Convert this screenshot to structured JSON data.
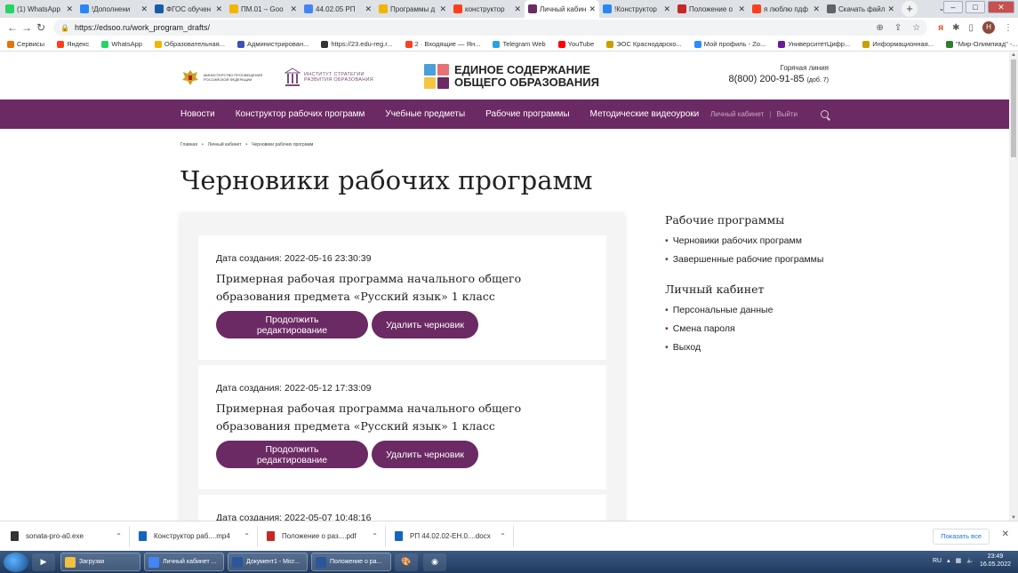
{
  "browser": {
    "tabs": [
      {
        "title": "(1) WhatsApp",
        "color": "#25d366",
        "active": false
      },
      {
        "title": "!Дополнени",
        "color": "#2787f5",
        "active": false
      },
      {
        "title": "ФГОС обучен",
        "color": "#1a5aa8",
        "active": false
      },
      {
        "title": "ПМ.01 – Goo",
        "color": "#f4b400",
        "active": false
      },
      {
        "title": "44.02.05 РП",
        "color": "#4285f4",
        "active": false
      },
      {
        "title": "Программы д",
        "color": "#f4b400",
        "active": false
      },
      {
        "title": "конструктор",
        "color": "#fc3f1d",
        "active": false
      },
      {
        "title": "Личный кабин",
        "color": "#6b2a63",
        "active": true
      },
      {
        "title": "!Конструктор",
        "color": "#2787f5",
        "active": false
      },
      {
        "title": "Положение о",
        "color": "#c62828",
        "active": false
      },
      {
        "title": "я люблю пдф",
        "color": "#fc3f1d",
        "active": false
      },
      {
        "title": "Скачать файл",
        "color": "#5f6368",
        "active": false
      }
    ],
    "url": "https://edsoo.ru/work_program_drafts/",
    "profile_initial": "Н",
    "bookmarks": [
      {
        "label": "Сервисы",
        "color": "#e8710a"
      },
      {
        "label": "Яндекс",
        "color": "#fc3f1d"
      },
      {
        "label": "WhatsApp",
        "color": "#25d366"
      },
      {
        "label": "Образовательная...",
        "color": "#f4b400"
      },
      {
        "label": "Администрирован...",
        "color": "#3f51b5"
      },
      {
        "label": "https://23.edu-reg.r...",
        "color": "#333333"
      },
      {
        "label": "2 · Входящие — Ян...",
        "color": "#fc3f1d"
      },
      {
        "label": "Telegram Web",
        "color": "#2aa3df"
      },
      {
        "label": "YouTube",
        "color": "#ff0000"
      },
      {
        "label": "ЭОС Краснодарско...",
        "color": "#c7a000"
      },
      {
        "label": "Мой профиль - Zo...",
        "color": "#2d8cff"
      },
      {
        "label": "УниверситетЦифр...",
        "color": "#6a1b9a"
      },
      {
        "label": "Информационная...",
        "color": "#c7a000"
      },
      {
        "label": "\"Мир-Олимпиад\" -...",
        "color": "#2e7d32"
      }
    ]
  },
  "site": {
    "logo_ministry": "МИНИСТЕРСТВО ПРОСВЕЩЕНИЯ РОССИЙСКОЙ ФЕДЕРАЦИИ",
    "logo_institute": "ИНСТИТУТ СТРАТЕГИИ РАЗВИТИЯ ОБРАЗОВАНИЯ",
    "brand_line1": "ЕДИНОЕ СОДЕРЖАНИЕ",
    "brand_line2": "ОБЩЕГО ОБРАЗОВАНИЯ",
    "hotline_label": "Горячая линия",
    "hotline_phone": "8(800) 200-91-85",
    "hotline_ext": "(доб. 7)",
    "nav": [
      "Новости",
      "Конструктор рабочих программ",
      "Учебные предметы",
      "Рабочие программы",
      "Методические видеоуроки"
    ],
    "account_link": "Личный кабинет",
    "logout_link": "Выйти",
    "separator": "|"
  },
  "breadcrumbs": [
    "Главная",
    "Личный кабинет",
    "Черновики рабочих программ"
  ],
  "page_title": "Черновики рабочих программ",
  "drafts": [
    {
      "date": "Дата создания: 2022-05-16 23:30:39",
      "title": "Примерная рабочая программа начального общего образования предмета «Русский язык» 1 класс",
      "continue": "Продолжить редактирование",
      "delete": "Удалить черновик"
    },
    {
      "date": "Дата создания: 2022-05-12 17:33:09",
      "title": "Примерная рабочая программа начального общего образования предмета «Русский язык» 1 класс",
      "continue": "Продолжить редактирование",
      "delete": "Удалить черновик"
    },
    {
      "date": "Дата создания: 2022-05-07 10:48:16"
    }
  ],
  "sidebar": {
    "section1_title": "Рабочие программы",
    "section1_items": [
      "Черновики рабочих программ",
      "Завершенные рабочие программы"
    ],
    "section2_title": "Личный кабинет",
    "section2_items": [
      "Персональные данные",
      "Смена пароля",
      "Выход"
    ]
  },
  "downloads": {
    "items": [
      {
        "name": "sonata-pro-a0.exe",
        "color": "#333333"
      },
      {
        "name": "Конструктор раб....mp4",
        "color": "#1565c0"
      },
      {
        "name": "Положение о раз....pdf",
        "color": "#c62828"
      },
      {
        "name": "РП 44.02.02-ЕН.0....docx",
        "color": "#1565c0"
      }
    ],
    "show_all": "Показать все"
  },
  "taskbar": {
    "buttons": [
      {
        "label": "Загрузки",
        "color": "#f0c040"
      },
      {
        "label": "Личный кабинет ...",
        "color": "#4285f4"
      },
      {
        "label": "Документ1 - Micr...",
        "color": "#2b579a"
      },
      {
        "label": "Положение о ра...",
        "color": "#2b579a"
      }
    ],
    "lang": "RU",
    "time": "23:49",
    "date": "16.05.2022"
  },
  "colors": {
    "accent": "#6b2a63"
  }
}
